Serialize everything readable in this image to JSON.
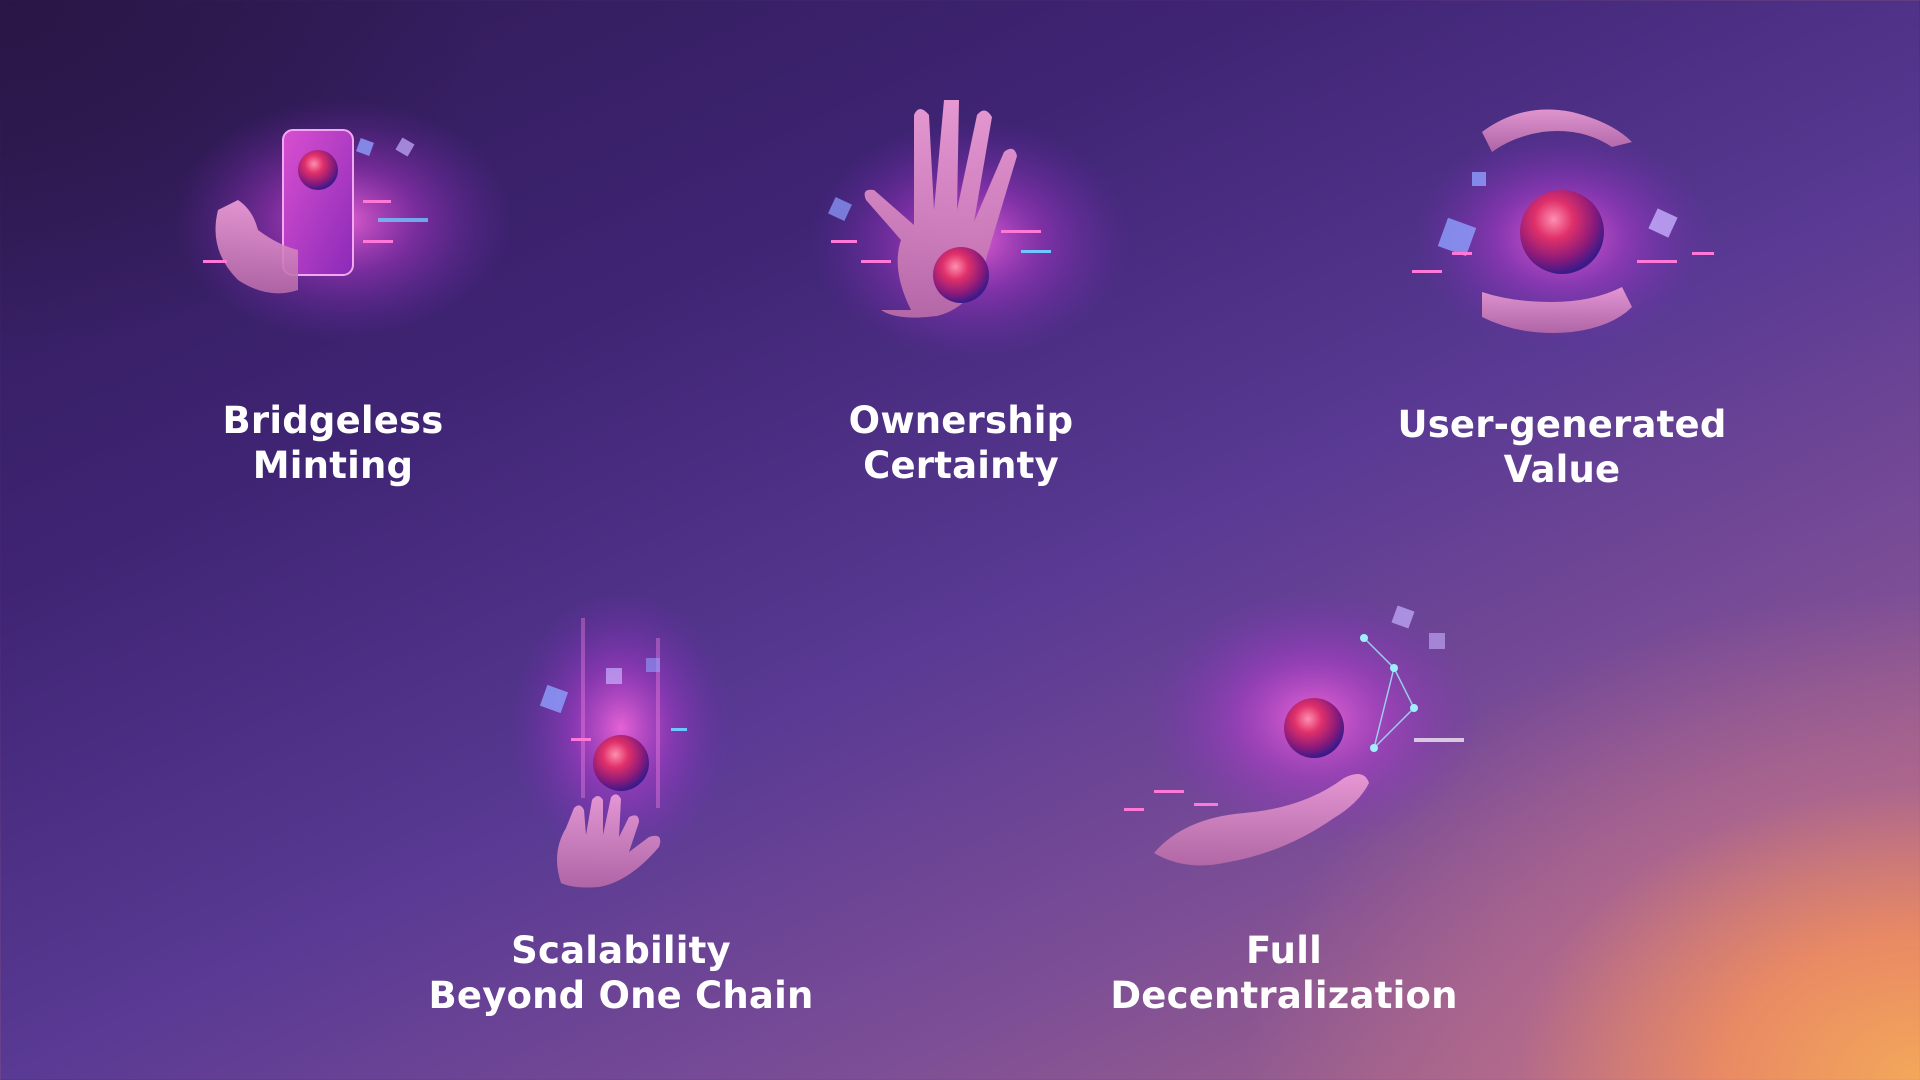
{
  "features": [
    {
      "id": "bridgeless-minting",
      "title_line1": "Bridgeless",
      "title_line2": "Minting",
      "icon": "phone-hand-orb-icon"
    },
    {
      "id": "ownership-certainty",
      "title_line1": "Ownership",
      "title_line2": "Certainty",
      "icon": "palm-orb-icon"
    },
    {
      "id": "user-generated-value",
      "title_line1": "User-generated",
      "title_line2": "Value",
      "icon": "cupped-hands-orb-icon"
    },
    {
      "id": "scalability",
      "title_line1": "Scalability",
      "title_line2": "Beyond One Chain",
      "icon": "rising-orb-hand-icon"
    },
    {
      "id": "full-decentralization",
      "title_line1": "Full",
      "title_line2": "Decentralization",
      "icon": "open-hand-orb-network-icon"
    }
  ],
  "colors": {
    "bg_dark": "#2e1a52",
    "bg_mid": "#5a3a94",
    "bg_warm": "#f3a85a",
    "orb": "#e0306a",
    "glow": "#e04bd0",
    "cube": "#8fa0ff",
    "text": "#ffffff"
  }
}
